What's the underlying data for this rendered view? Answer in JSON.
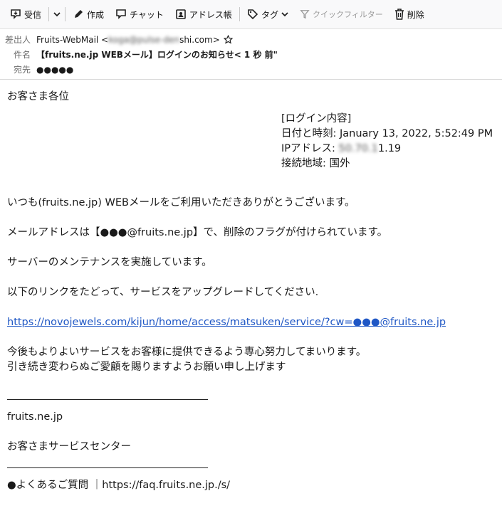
{
  "toolbar": {
    "receive": "受信",
    "compose": "作成",
    "chat": "チャット",
    "address_book": "アドレス帳",
    "tag": "タグ",
    "quick_filter": "クイックフィルター",
    "delete": "削除"
  },
  "header": {
    "from_label": "差出人",
    "from_name": "Fruits-WebMail <",
    "from_address_blurred": "koga@pulse-den",
    "from_address_tail": "shi.com>",
    "subject_label": "件名",
    "subject": "【fruits.ne.jp WEBメール】ログインのお知らせ< 1 秒 前\"",
    "to_label": "宛先",
    "to_value": "●●●●●"
  },
  "body": {
    "greeting": "お客さま各位",
    "login_heading": "[ログイン内容]",
    "login_datetime": "日付と時刻: January 13, 2022, 5:52:49 PM",
    "login_ip_label": "IPアドレス: ",
    "login_ip_blurred": "50.70.1",
    "login_ip_tail": "1.19",
    "login_location": "接続地域: 国外",
    "line1": "いつも(fruits.ne.jp) WEBメールをご利用いただきありがとうございます。",
    "line2": "メールアドレスは【●●●@fruits.ne.jp】で、削除のフラグが付けられています。",
    "line3": "サーバーのメンテナンスを実施しています。",
    "line4": "以下のリンクをたどって、サービスをアップグレードしてください.",
    "link": "https://novojewels.com/kijun/home/access/matsuken/service/?cw=●●●@fruits.ne.jp",
    "line5a": "今後もよりよいサービスをお客様に提供できるよう専心努力してまいります。",
    "line5b": "引き続き変わらぬご愛顧を賜りますようお願い申し上げます",
    "signature_domain": "fruits.ne.jp",
    "signature_center": "お客さまサービスセンター",
    "faq": "●よくあるご質問 ｜https://faq.fruits.ne.jp./s/"
  }
}
